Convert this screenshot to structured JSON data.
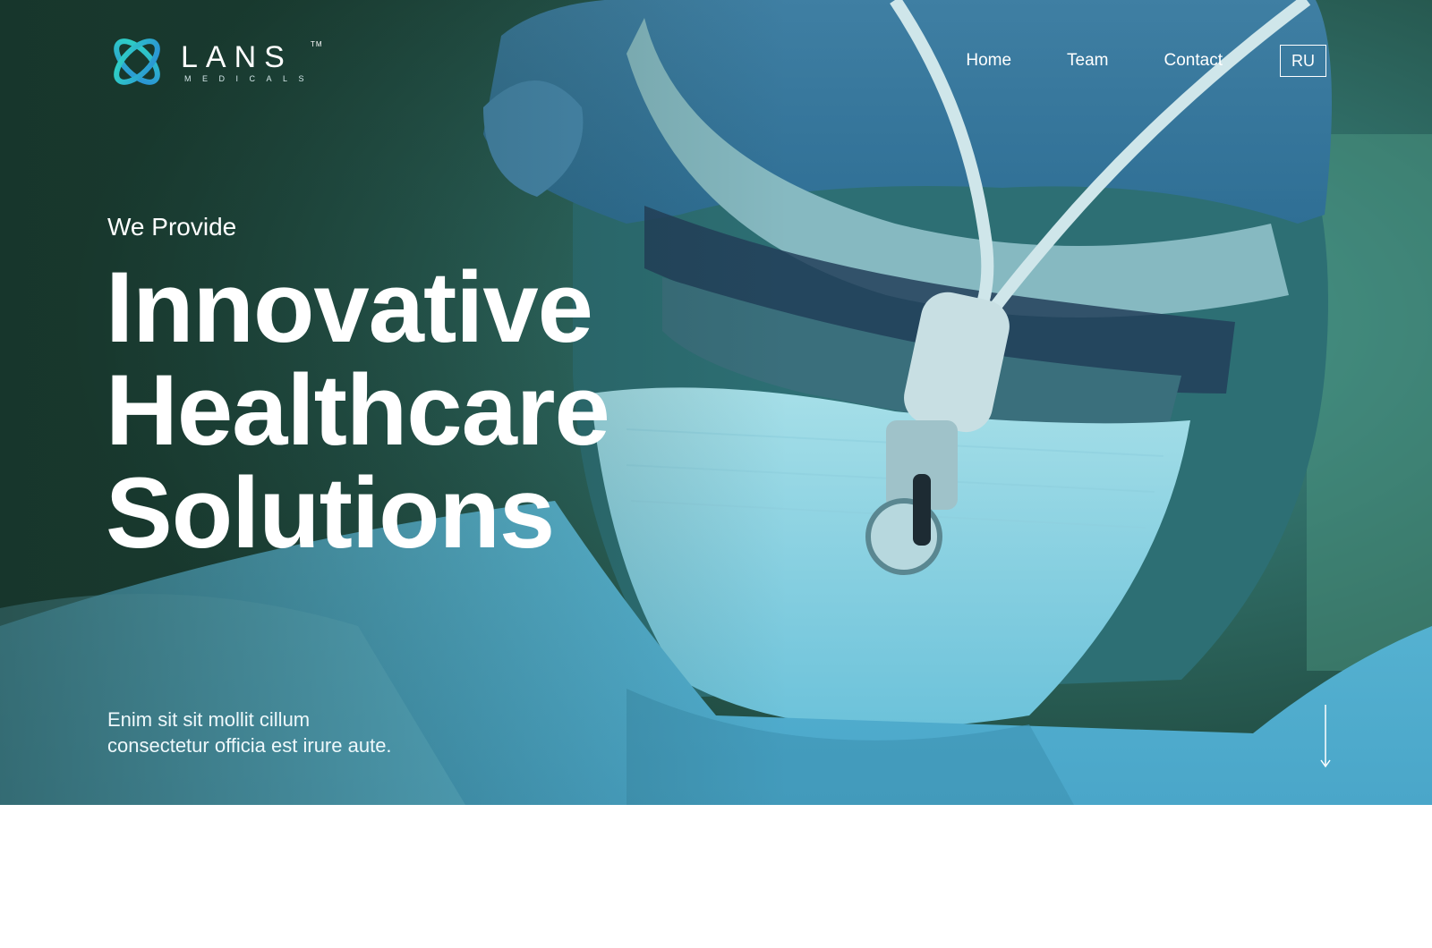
{
  "brand": {
    "name": "LANS",
    "trademark": "TM",
    "subtitle": "MEDICALS",
    "accent_colors": [
      "#2fd4c4",
      "#2a8fd6"
    ]
  },
  "nav": {
    "items": [
      {
        "label": "Home"
      },
      {
        "label": "Team"
      },
      {
        "label": "Contact"
      }
    ],
    "language": "RU"
  },
  "hero": {
    "eyebrow": "We Provide",
    "headline": [
      "Innovative",
      "Healthcare",
      "Solutions"
    ],
    "tagline": [
      "Enim sit sit mollit cillum",
      "consectetur officia est irure aute."
    ],
    "scroll_icon": "arrow-down-icon",
    "overlay_color": "#3a9cbf"
  }
}
